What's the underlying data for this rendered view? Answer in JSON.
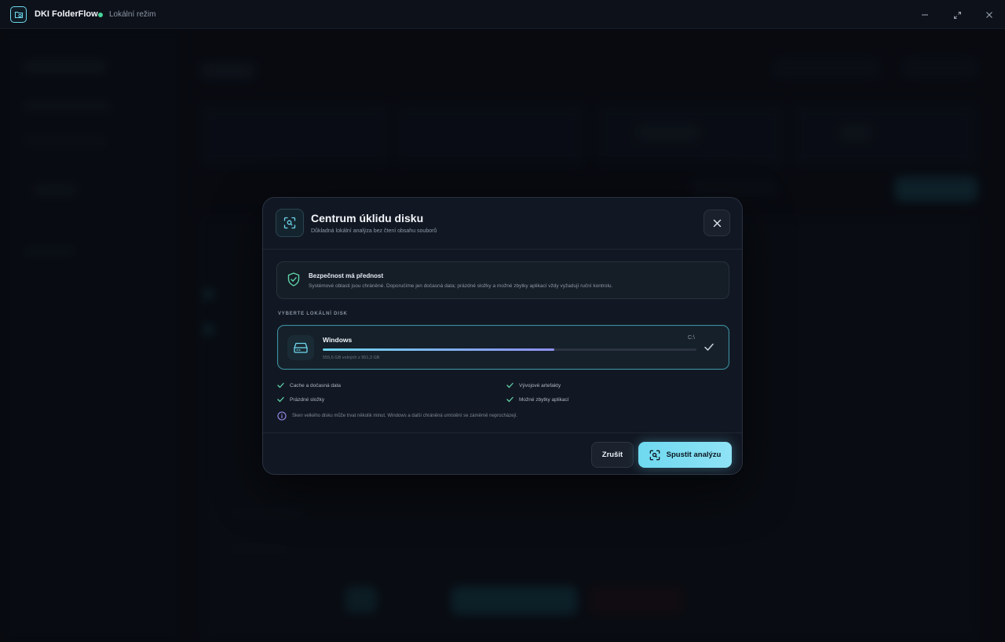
{
  "titlebar": {
    "app_name": "DKI FolderFlow",
    "status_text": "Lokální režim",
    "status_color": "#46d39a"
  },
  "modal": {
    "title": "Centrum úklidu disku",
    "subtitle": "Důkladná lokální analýza bez čtení obsahu souborů",
    "icon": "scan-icon",
    "safety": {
      "title": "Bezpečnost má přednost",
      "text": "Systémové oblasti jsou chráněné. Doporučíme jen dočasná data; prázdné složky a možné zbytky aplikací vždy vyžadují ruční kontrolu."
    },
    "section_label": "VYBERTE LOKÁLNÍ DISK",
    "disk": {
      "name": "Windows",
      "letter": "C:\\",
      "usage": "555,6 GB volných z 951,3 GB",
      "fill_fraction": 0.62,
      "selected": true
    },
    "features": [
      "Cache a dočasná data",
      "Vývojové artefakty",
      "Prázdné složky",
      "Možné zbytky aplikací"
    ],
    "info": "Sken velkého disku může trvat několik minut. Windows a další chráněná umístění se záměrně neprocházejí.",
    "cancel_label": "Zrušit",
    "primary_label": "Spustit analýzu"
  },
  "colors": {
    "accent": "#6fd6ee",
    "accent_purple": "#8f8ff0",
    "modal_bg": "#121823",
    "page_bg": "#0b0e15"
  }
}
